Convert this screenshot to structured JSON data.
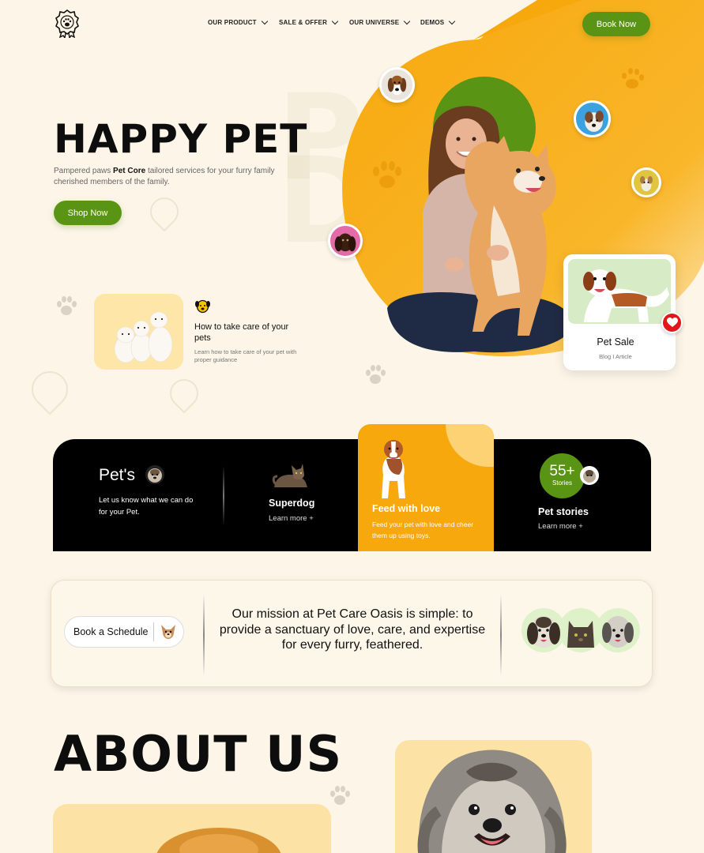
{
  "nav": {
    "items": [
      {
        "label": "OUR PRODUCT"
      },
      {
        "label": "SALE & OFFER"
      },
      {
        "label": "OUR UNIVERSE"
      },
      {
        "label": "DEMOS"
      }
    ],
    "book_label": "Book Now"
  },
  "hero": {
    "title": "HAPPY PET",
    "desc_prefix": "Pampered paws ",
    "desc_brand": "Pet Core",
    "desc_suffix": " tailored services for your furry family cherished members of the family.",
    "shop_label": "Shop Now"
  },
  "care": {
    "title": "How  to take care of your pets",
    "subtitle": "Learn how to take care of your pet with proper guidance"
  },
  "sale_card": {
    "title": "Pet Sale",
    "subtitle": "Blog I Article"
  },
  "band": {
    "pets": {
      "title": "Pet's",
      "desc": "Let us know what we can do for your Pet."
    },
    "superdog": {
      "title": "Superdog",
      "link": "Learn more +"
    },
    "feed": {
      "title": "Feed with love",
      "desc": "Feed your pet with love and cheer them up using toys."
    },
    "stories": {
      "count": "55+",
      "count_label": "Stories",
      "title": "Pet stories",
      "link": "Learn more +"
    }
  },
  "mission": {
    "schedule_label": "Book a Schedule",
    "text": "Our mission at Pet Care Oasis is simple: to provide a sanctuary of love, care, and expertise for every furry, feathered."
  },
  "about": {
    "title": "ABOUT US"
  },
  "colors": {
    "accent_green": "#5a9414",
    "accent_orange": "#f6a80c",
    "background": "#fdf6e8",
    "badge_red": "#e3161c"
  }
}
